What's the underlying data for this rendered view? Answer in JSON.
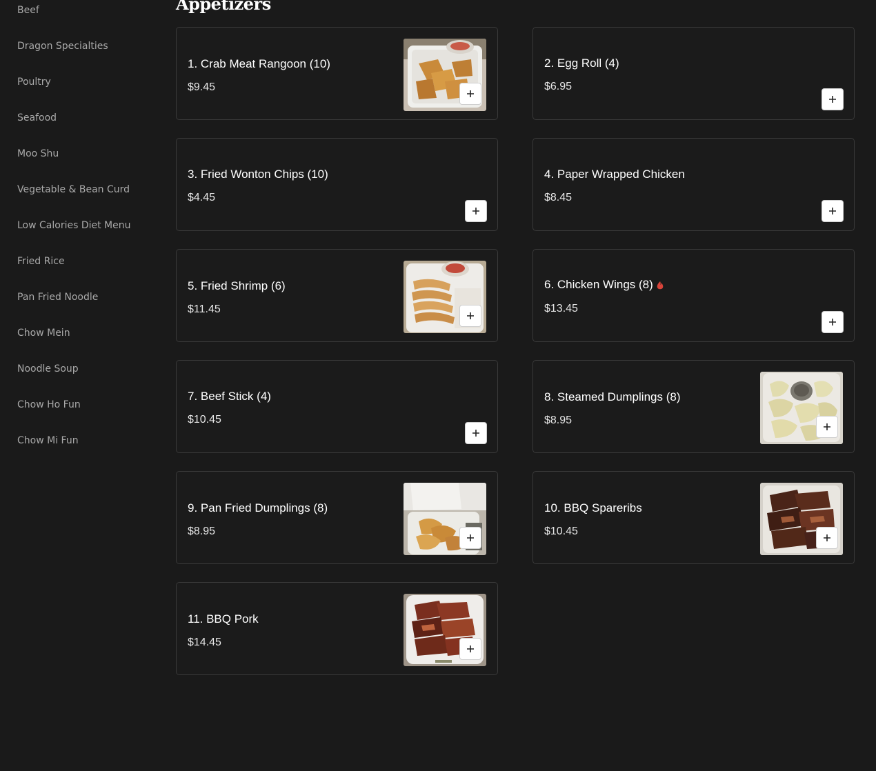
{
  "sidebar": {
    "categories": [
      "Beef",
      "Dragon Specialties",
      "Poultry",
      "Seafood",
      "Moo Shu",
      "Vegetable & Bean Curd",
      "Low Calories Diet Menu",
      "Fried Rice",
      "Pan Fried Noodle",
      "Chow Mein",
      "Noodle Soup",
      "Chow Ho Fun",
      "Chow Mi Fun"
    ]
  },
  "section": {
    "title": "Appetizers"
  },
  "items": [
    {
      "name": "1. Crab Meat Rangoon (10)",
      "price": "$9.45",
      "has_image": true,
      "image": "crab-rangoon-photo",
      "spicy": false
    },
    {
      "name": "2. Egg Roll (4)",
      "price": "$6.95",
      "has_image": false,
      "spicy": false
    },
    {
      "name": "3. Fried Wonton Chips (10)",
      "price": "$4.45",
      "has_image": false,
      "spicy": false
    },
    {
      "name": "4. Paper Wrapped Chicken",
      "price": "$8.45",
      "has_image": false,
      "spicy": false
    },
    {
      "name": "5. Fried Shrimp (6)",
      "price": "$11.45",
      "has_image": true,
      "image": "fried-shrimp-photo",
      "spicy": false
    },
    {
      "name": "6. Chicken Wings (8)",
      "price": "$13.45",
      "has_image": false,
      "spicy": true
    },
    {
      "name": "7. Beef Stick (4)",
      "price": "$10.45",
      "has_image": false,
      "spicy": false
    },
    {
      "name": "8. Steamed Dumplings (8)",
      "price": "$8.95",
      "has_image": true,
      "image": "steamed-dumplings-photo",
      "spicy": false
    },
    {
      "name": "9. Pan Fried Dumplings (8)",
      "price": "$8.95",
      "has_image": true,
      "image": "pan-fried-dumplings-photo",
      "spicy": false
    },
    {
      "name": "10. BBQ Spareribs",
      "price": "$10.45",
      "has_image": true,
      "image": "bbq-spareribs-photo",
      "spicy": false
    },
    {
      "name": "11. BBQ Pork",
      "price": "$14.45",
      "has_image": true,
      "image": "bbq-pork-photo",
      "spicy": false
    }
  ],
  "icons": {
    "add": "plus-icon",
    "spicy": "chili-pepper-icon"
  },
  "colors": {
    "background": "#1a1a1a",
    "card_border": "#3a3a3a",
    "sidebar_text": "#a9a9a9",
    "spicy": "#d9443a"
  }
}
